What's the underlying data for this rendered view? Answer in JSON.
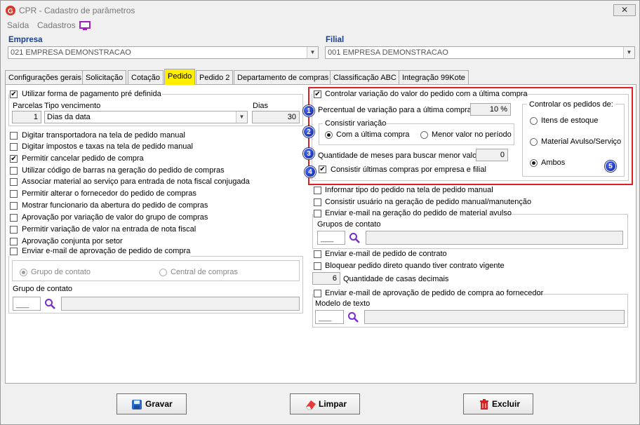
{
  "window": {
    "title": "CPR - Cadastro de parâmetros",
    "close_label": "✕"
  },
  "menu": [
    "Saída",
    "Cadastros"
  ],
  "empresa": {
    "label": "Empresa",
    "value": "021 EMPRESA DEMONSTRACAO"
  },
  "filial": {
    "label": "Filial",
    "value": "001 EMPRESA DEMONSTRACAO"
  },
  "tabs": [
    "Configurações gerais",
    "Solicitação",
    "Cotação",
    "Pedido",
    "Pedido 2",
    "Departamento de compras",
    "Classificação ABC",
    "Integração 99Kote"
  ],
  "left": {
    "forma_pag": {
      "label": "Utilizar forma de pagamento pré definida",
      "checked": true
    },
    "parcelas_label": "Parcelas",
    "parcelas_value": "1",
    "tipo_label": "Tipo vencimento",
    "tipo_value": "Dias da data",
    "dias_label": "Dias",
    "dias_value": "30",
    "checks": [
      {
        "label": "Digitar transportadora na tela de pedido manual",
        "checked": false
      },
      {
        "label": "Digitar impostos e taxas na tela de pedido manual",
        "checked": false
      },
      {
        "label": "Permitir cancelar pedido de compra",
        "checked": true
      },
      {
        "label": "Utilizar código de barras na geração do pedido de compras",
        "checked": false
      },
      {
        "label": "Associar material ao serviço para entrada de nota fiscal conjugada",
        "checked": false
      },
      {
        "label": "Permitir alterar o fornecedor do pedido de compras",
        "checked": false
      },
      {
        "label": "Mostrar funcionario da abertura do pedido de compras",
        "checked": false
      },
      {
        "label": "Aprovação por variação de valor do grupo de compras",
        "checked": false
      },
      {
        "label": "Permitir variação de valor na entrada de nota fiscal",
        "checked": false
      },
      {
        "label": "Aprovação conjunta por setor",
        "checked": false
      }
    ],
    "enviar_aprov": {
      "label": "Enviar e-mail de aprovação de pedido de compra",
      "checked": false
    },
    "radio_grupo": "Grupo de contato",
    "radio_central": "Central de compras",
    "grupo_contato_label": "Grupo de contato"
  },
  "right": {
    "controlar": {
      "label": "Controlar variação do valor do pedido com a última compra",
      "checked": true
    },
    "percentual_label": "Percentual de variação para a última compra",
    "percentual_value": "10 %",
    "consistir_label": "Consistir variação",
    "radio_ultima": "Com a última compra",
    "radio_menor": "Menor valor no período",
    "meses_label": "Quantidade de meses para buscar menor valor",
    "meses_value": "0",
    "consistir_ultimas": {
      "label": "Consistir últimas compras por empresa e filial",
      "checked": true
    },
    "controlar_pedidos_label": "Controlar os pedidos de:",
    "radio_itens": "Itens de estoque",
    "radio_material": "Material Avulso/Serviço",
    "radio_ambos": "Ambos",
    "badges": [
      "1",
      "2",
      "3",
      "4",
      "5"
    ],
    "informar": {
      "label": "Informar tipo do pedido na tela de pedido manual",
      "checked": false
    },
    "consistir_usuario": {
      "label": "Consistir usuário na geração de pedido manual/manutenção",
      "checked": false
    },
    "enviar_avulso": {
      "label": "Enviar e-mail na geração do pedido de material avulso",
      "checked": false
    },
    "grupos_contato_label": "Grupos de contato",
    "enviar_contrato": {
      "label": "Enviar e-mail de pedido de contrato",
      "checked": false
    },
    "bloquear": {
      "label": "Bloquear pedido direto quando tiver contrato vigente",
      "checked": false
    },
    "casas_value": "6",
    "casas_label": "Quantidade de casas decimais",
    "enviar_fornecedor": {
      "label": "Enviar e-mail de aprovação de pedido de compra ao fornecedor",
      "checked": false
    },
    "modelo_label": "Modelo de texto"
  },
  "buttons": {
    "gravar": "Gravar",
    "limpar": "Limpar",
    "excluir": "Excluir"
  },
  "colors": {
    "highlight_tab": "#ffee00",
    "red_box": "#e02020",
    "badge": "#1a2fc8",
    "label_blue": "#1b3f8c"
  }
}
